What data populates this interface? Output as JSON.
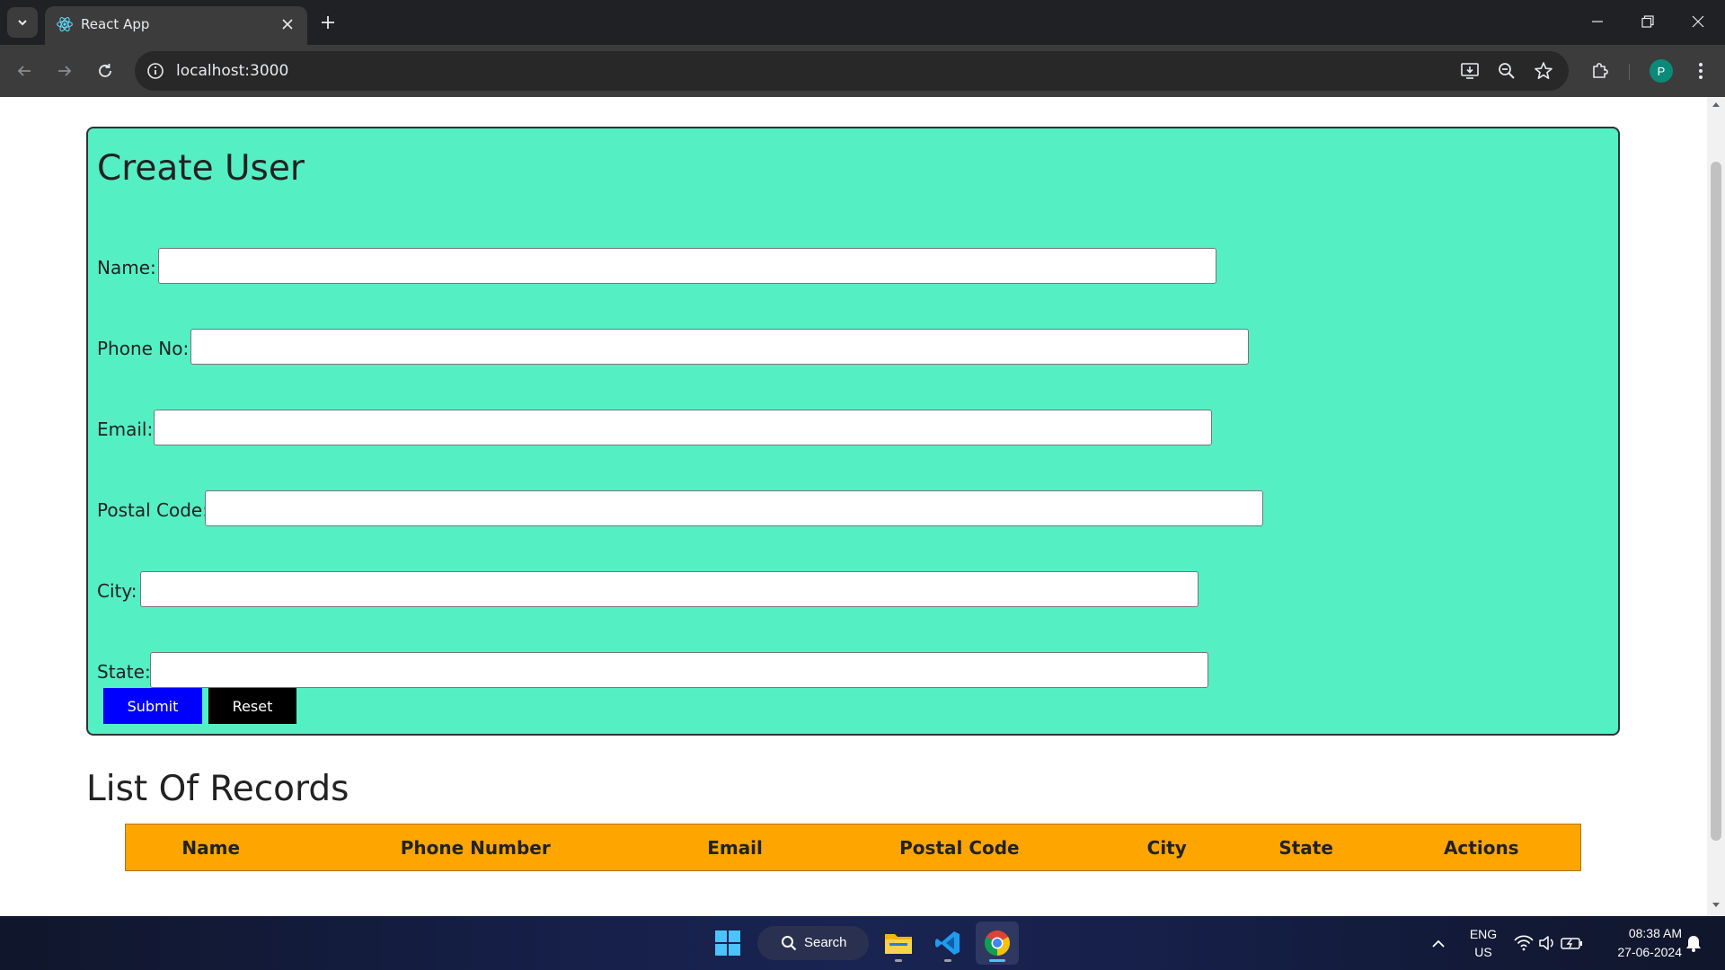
{
  "browser": {
    "tab_title": "React App",
    "url": "localhost:3000",
    "profile_initial": "P"
  },
  "form": {
    "title": "Create User",
    "fields": [
      {
        "label": "Name:",
        "value": ""
      },
      {
        "label": "Phone No:",
        "value": ""
      },
      {
        "label": "Email:",
        "value": ""
      },
      {
        "label": "Postal Code:",
        "value": ""
      },
      {
        "label": "City:",
        "value": ""
      },
      {
        "label": "State:",
        "value": ""
      }
    ],
    "submit_label": "Submit",
    "reset_label": "Reset",
    "colors": {
      "card": "#55efc4",
      "submit": "#0000ff",
      "reset": "#000000"
    }
  },
  "records": {
    "title": "List Of Records",
    "columns": [
      "Name",
      "Phone Number",
      "Email",
      "Postal Code",
      "City",
      "State",
      "Actions"
    ],
    "header_color": "#ffa500"
  },
  "taskbar": {
    "search_label": "Search",
    "lang_line1": "ENG",
    "lang_line2": "US",
    "time": "08:38 AM",
    "date": "27-06-2024"
  }
}
